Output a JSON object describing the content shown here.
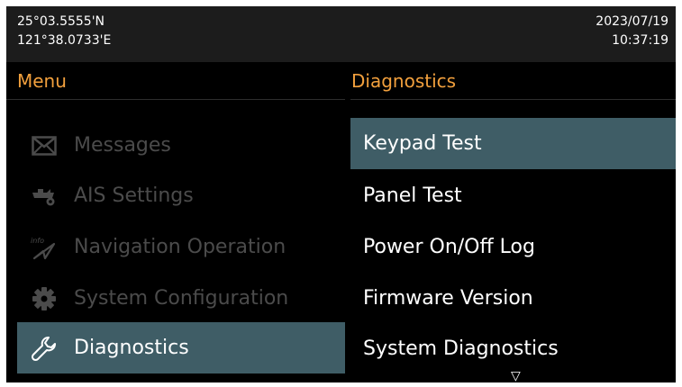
{
  "status": {
    "latitude": "25°03.5555'N",
    "longitude": "121°38.0733'E",
    "date": "2023/07/19",
    "time": "10:37:19"
  },
  "menu": {
    "title": "Menu",
    "items": [
      {
        "label": "Messages",
        "icon": "envelope-icon",
        "active": false
      },
      {
        "label": "AIS Settings",
        "icon": "ship-settings-icon",
        "active": false
      },
      {
        "label": "Navigation Operation",
        "icon": "navigation-info-icon",
        "active": false
      },
      {
        "label": "System Configuration",
        "icon": "gear-icon",
        "active": false
      },
      {
        "label": "Diagnostics",
        "icon": "wrench-icon",
        "active": true
      }
    ]
  },
  "diagnostics": {
    "title": "Diagnostics",
    "items": [
      {
        "label": "Keypad Test",
        "selected": true
      },
      {
        "label": "Panel Test",
        "selected": false
      },
      {
        "label": "Power On/Off Log",
        "selected": false
      },
      {
        "label": "Firmware Version",
        "selected": false
      },
      {
        "label": "System Diagnostics",
        "selected": false
      }
    ],
    "scroll_indicator": "▽"
  },
  "colors": {
    "background": "#000000",
    "status_bar": "#1c1c1c",
    "header_text": "#f2a03d",
    "highlight": "#3f5d66",
    "dimmed_text": "#4b4b4b",
    "text": "#ffffff"
  }
}
